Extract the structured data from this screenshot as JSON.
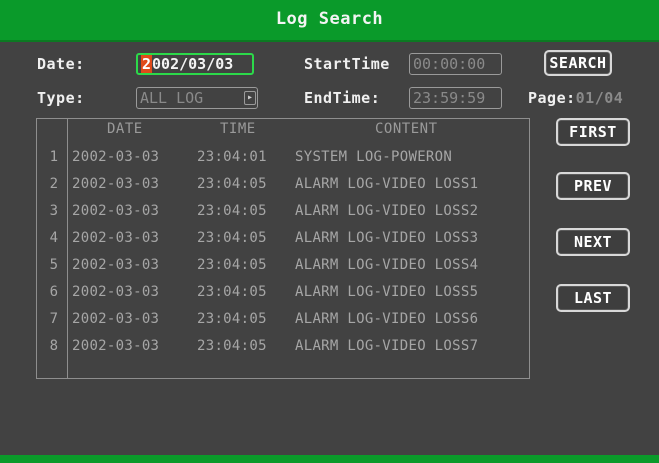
{
  "title": "Log Search",
  "labels": {
    "date": "Date:",
    "type": "Type:",
    "start_time": "StartTime",
    "end_time": "EndTime:",
    "page": "Page:"
  },
  "fields": {
    "date_first_char": "2",
    "date_rest": "002/03/03",
    "start_time": "00:00:00",
    "end_time": "23:59:59",
    "type": "ALL LOG",
    "type_arrow": "▸"
  },
  "page_value": "01/04",
  "buttons": {
    "search": "SEARCH",
    "first": "FIRST",
    "prev": "PREV",
    "next": "NEXT",
    "last": "LAST"
  },
  "table": {
    "headers": {
      "date": "DATE",
      "time": "TIME",
      "content": "CONTENT"
    },
    "rows": [
      {
        "idx": "1",
        "date": "2002-03-03",
        "time": "23:04:01",
        "content": "SYSTEM LOG-POWERON"
      },
      {
        "idx": "2",
        "date": "2002-03-03",
        "time": "23:04:05",
        "content": "ALARM LOG-VIDEO LOSS1"
      },
      {
        "idx": "3",
        "date": "2002-03-03",
        "time": "23:04:05",
        "content": "ALARM LOG-VIDEO LOSS2"
      },
      {
        "idx": "4",
        "date": "2002-03-03",
        "time": "23:04:05",
        "content": "ALARM LOG-VIDEO LOSS3"
      },
      {
        "idx": "5",
        "date": "2002-03-03",
        "time": "23:04:05",
        "content": "ALARM LOG-VIDEO LOSS4"
      },
      {
        "idx": "6",
        "date": "2002-03-03",
        "time": "23:04:05",
        "content": "ALARM LOG-VIDEO LOSS5"
      },
      {
        "idx": "7",
        "date": "2002-03-03",
        "time": "23:04:05",
        "content": "ALARM LOG-VIDEO LOSS6"
      },
      {
        "idx": "8",
        "date": "2002-03-03",
        "time": "23:04:05",
        "content": "ALARM LOG-VIDEO LOSS7"
      }
    ]
  },
  "colors": {
    "title_bar": "#0a9a2a",
    "screen_bg": "#424242",
    "date_highlight": "#2cd94a",
    "cursor_char": "#e04a1a"
  }
}
